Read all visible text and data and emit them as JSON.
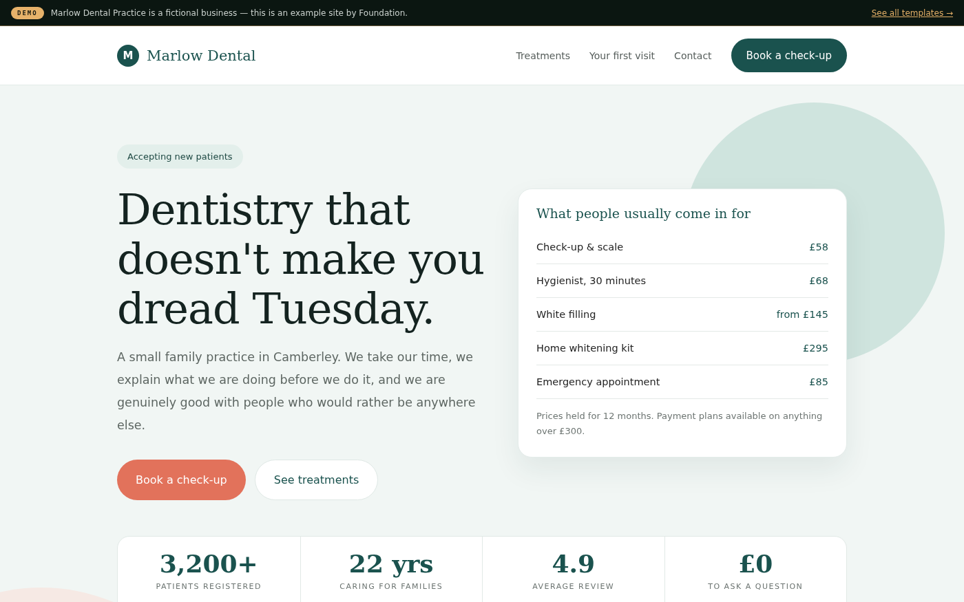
{
  "banner": {
    "badge": "DEMO",
    "message": "Marlow Dental Practice is a fictional business — this is an example site by Foundation.",
    "link": "See all templates →"
  },
  "header": {
    "logo_letter": "M",
    "brand": "Marlow Dental",
    "nav": [
      "Treatments",
      "Your first visit",
      "Contact"
    ],
    "cta": "Book a check-up"
  },
  "hero": {
    "tag": "Accepting new patients",
    "heading": "Dentistry that doesn't make you dread Tuesday.",
    "intro": "A small family practice in Camberley. We take our time, we explain what we are doing before we do it, and we are genuinely good with people who would rather be anywhere else.",
    "buttons": [
      {
        "label": "Book a check-up",
        "kind": "primary"
      },
      {
        "label": "See treatments",
        "kind": "secondary"
      }
    ]
  },
  "price_card": {
    "title": "What people usually come in for",
    "items": [
      {
        "name": "Check-up & scale",
        "price": "£58"
      },
      {
        "name": "Hygienist, 30 minutes",
        "price": "£68"
      },
      {
        "name": "White filling",
        "price": "from £145"
      },
      {
        "name": "Home whitening kit",
        "price": "£295"
      },
      {
        "name": "Emergency appointment",
        "price": "£85"
      }
    ],
    "note": "Prices held for 12 months. Payment plans available on anything over £300."
  },
  "stats": [
    {
      "value": "3,200+",
      "label": "PATIENTS REGISTERED"
    },
    {
      "value": "22 yrs",
      "label": "CARING FOR FAMILIES"
    },
    {
      "value": "4.9",
      "label": "AVERAGE REVIEW"
    },
    {
      "value": "£0",
      "label": "TO ASK A QUESTION"
    }
  ]
}
